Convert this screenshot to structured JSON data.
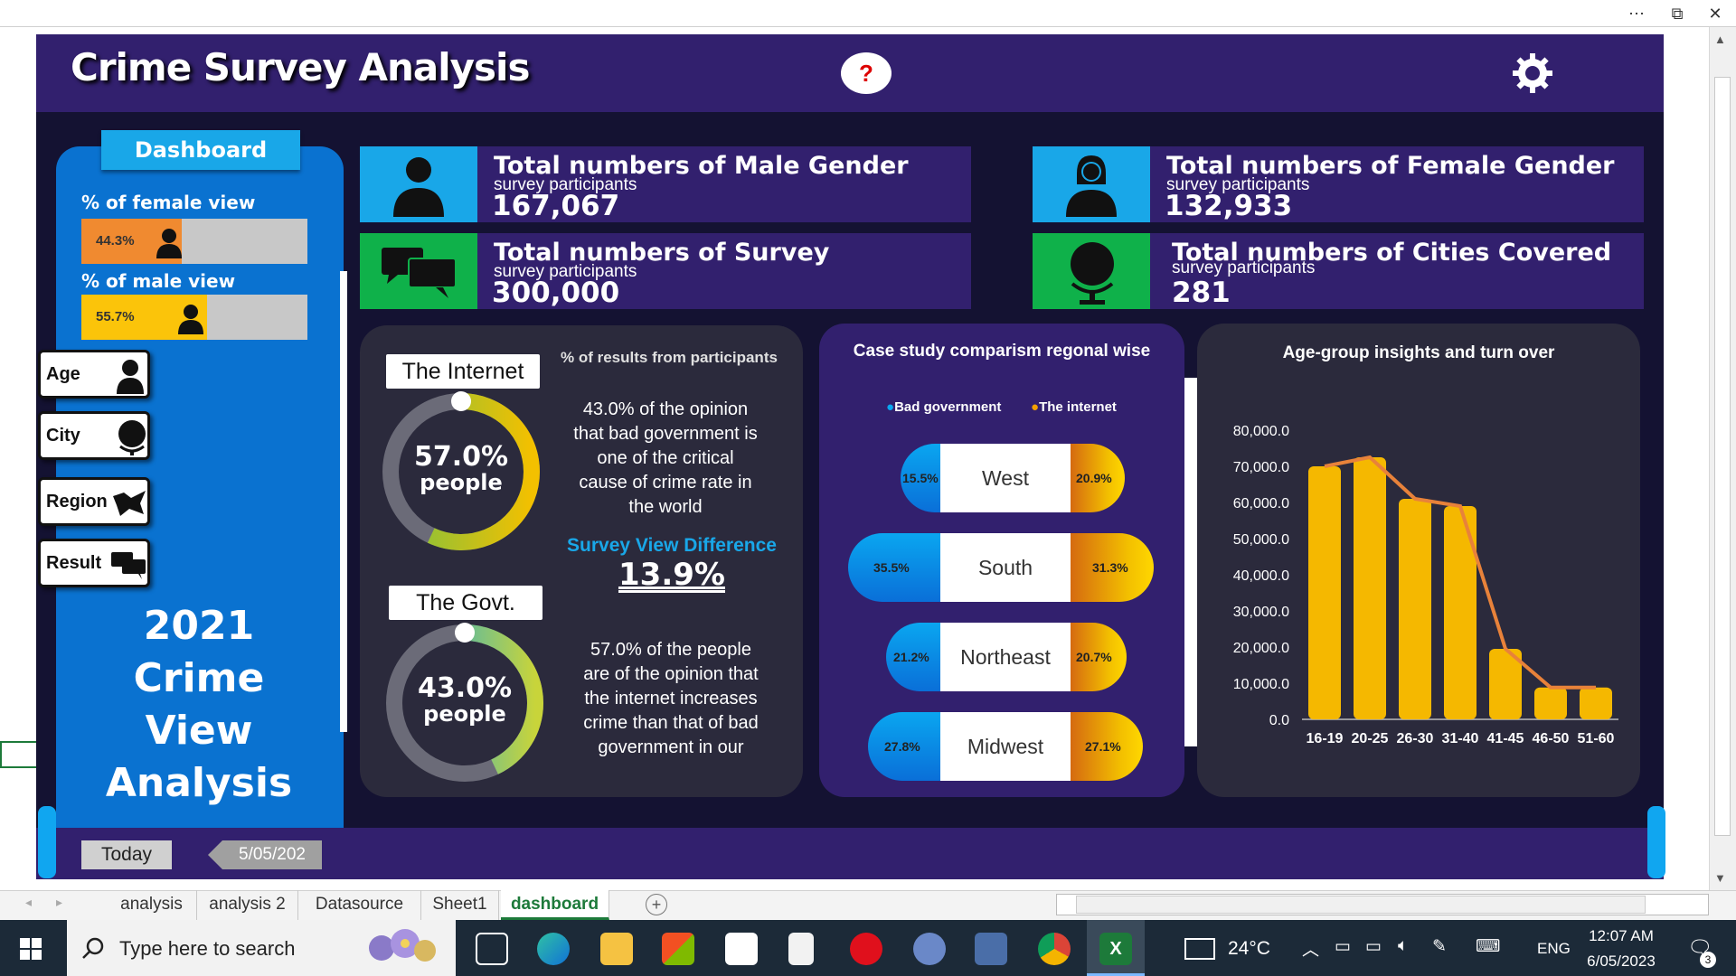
{
  "window": {
    "more_icon": "⋯",
    "restore_icon": "⧉",
    "close_icon": "✕"
  },
  "header": {
    "title": "Crime Survey Analysis",
    "help_label": "?"
  },
  "sidebar": {
    "tab_label": "Dashboard",
    "female_view_label": "% of female view",
    "female_view_pct": "44.3%",
    "female_view_fraction": 0.443,
    "male_view_label": "% of male view",
    "male_view_pct": "55.7%",
    "male_view_fraction": 0.557,
    "nav": [
      {
        "label": "Age",
        "icon": "person-icon"
      },
      {
        "label": "City",
        "icon": "globe-icon"
      },
      {
        "label": "Region",
        "icon": "map-icon"
      },
      {
        "label": "Result",
        "icon": "chat-icon"
      }
    ],
    "big_title": [
      "2021",
      "Crime",
      "View",
      "Analysis"
    ]
  },
  "kpis": {
    "male": {
      "title": "Total numbers of Male Gender",
      "subtitle": "survey participants",
      "value": "167,067"
    },
    "female": {
      "title": "Total numbers of Female Gender",
      "subtitle": "survey participants",
      "value": "132,933"
    },
    "survey": {
      "title": "Total numbers of Survey",
      "subtitle": "survey participants",
      "value": "300,000"
    },
    "cities": {
      "title": "Total numbers of Cities Covered",
      "subtitle": "survey participants",
      "value": "281"
    }
  },
  "opinion_panel": {
    "heading": "% of results from participants",
    "internet_tag": "The Internet",
    "internet_pct": "57.0%",
    "internet_fraction": 0.57,
    "internet_unit": "people",
    "govt_tag": "The Govt.",
    "govt_pct": "43.0%",
    "govt_fraction": 0.43,
    "govt_unit": "people",
    "text_govt": [
      "43.0% of the opinion",
      "that bad government is",
      "one of the critical",
      "cause of crime rate in",
      "the world"
    ],
    "diff_label": "Survey View Difference",
    "diff_value": "13.9%",
    "text_internet": [
      "57.0% of the people",
      "are of the opinion that",
      "the internet increases",
      "crime than that of bad",
      "government in our"
    ]
  },
  "region_panel": {
    "title": "Case study comparism regonal wise",
    "legend_bad": "Bad government",
    "legend_internet": "The internet",
    "rows": [
      {
        "region": "West",
        "bad": "15.5%",
        "internet": "20.9%"
      },
      {
        "region": "South",
        "bad": "35.5%",
        "internet": "31.3%"
      },
      {
        "region": "Northeast",
        "bad": "21.2%",
        "internet": "20.7%"
      },
      {
        "region": "Midwest",
        "bad": "27.8%",
        "internet": "27.1%"
      }
    ]
  },
  "chart_data": {
    "type": "bar",
    "title": "Age-group insights and turn over",
    "categories": [
      "16-19",
      "20-25",
      "26-30",
      "31-40",
      "41-45",
      "46-50",
      "51-60"
    ],
    "values": [
      70000,
      72500,
      61000,
      59000,
      19500,
      8800,
      8800
    ],
    "overlay_line": true,
    "ylim": [
      0,
      80000
    ],
    "yticks": [
      "80,000.0",
      "70,000.0",
      "60,000.0",
      "50,000.0",
      "40,000.0",
      "30,000.0",
      "20,000.0",
      "10,000.0",
      "0.0"
    ],
    "bar_color": "#f5b800",
    "line_color": "#e8823a"
  },
  "footer": {
    "today_label": "Today",
    "date_value": "5/05/202"
  },
  "sheets": [
    "analysis",
    "analysis 2",
    "Datasource",
    "Sheet1",
    "dashboard"
  ],
  "active_sheet": "dashboard",
  "taskbar": {
    "search_placeholder": "Type here to search",
    "weather": "24°C",
    "lang": "ENG",
    "time": "12:07 AM",
    "date": "6/05/2023",
    "notifications": "3"
  },
  "colors": {
    "dash_bg": "#2a1a5a",
    "sidebar": "#0a72d0",
    "accent_cyan": "#19a7e8",
    "male_icon_bg": "#19a7e8",
    "green_icon_bg": "#0fb14a"
  }
}
